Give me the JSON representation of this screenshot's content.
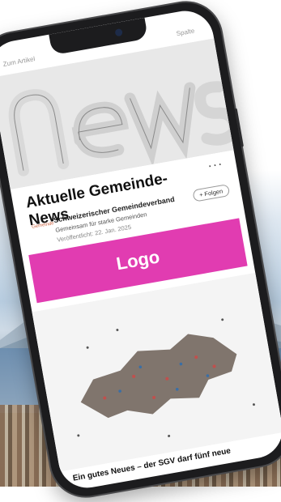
{
  "screen": {
    "topbar": {
      "left_label": "Zum Artikel",
      "right_label": "Spalte"
    },
    "hero": {
      "image": "news-newspaper-rolls"
    },
    "article": {
      "title": "Aktuelle Gemeinde-News",
      "more_menu": "···"
    },
    "author": {
      "logo_text": "Gemeinde",
      "name": "Schweizerischer Gemeindeverband",
      "subtitle": "Gemeinsam für starke Gemeinden",
      "published": "Veröffentlicht: 22. Jan. 2025",
      "follow_label": "+ Folgen"
    },
    "banner": {
      "label": "Logo",
      "color": "#e13cb1"
    },
    "illustration": {
      "image": "crowd-forming-switzerland-map"
    },
    "snippet": "Ein gutes Neues – der SGV darf fünf neue"
  },
  "colors": {
    "accent": "#e13cb1",
    "phone_frame": "#1c1c1e"
  }
}
